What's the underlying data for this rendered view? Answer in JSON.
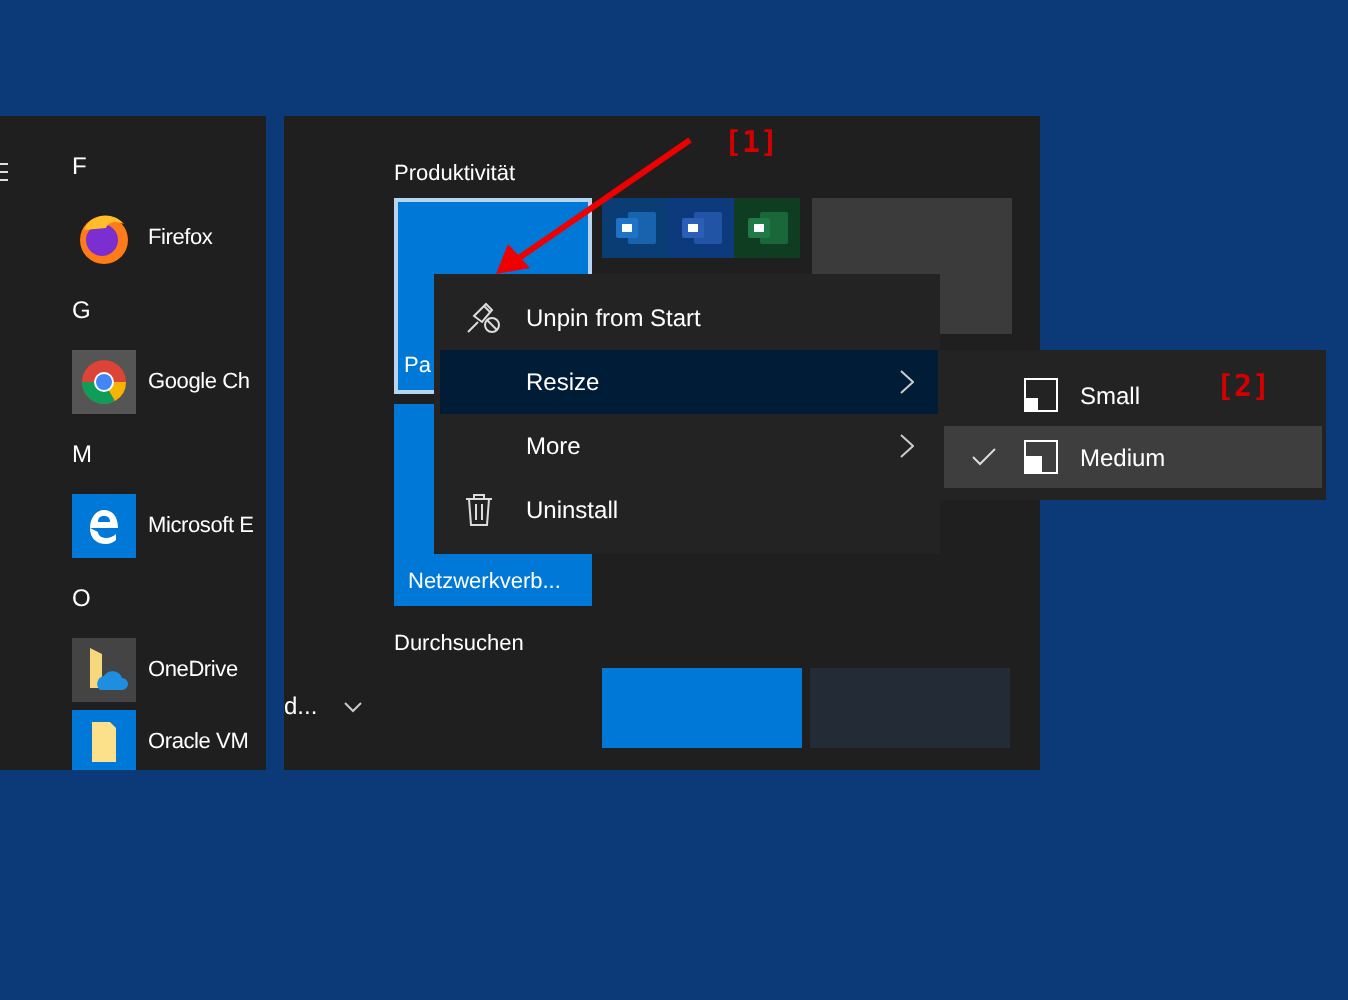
{
  "app_list": {
    "groups": [
      {
        "letter": "F",
        "apps": [
          {
            "name": "Firefox",
            "kind": "firefox"
          }
        ]
      },
      {
        "letter": "G",
        "apps": [
          {
            "name": "Google Ch",
            "kind": "chrome"
          }
        ]
      },
      {
        "letter": "M",
        "apps": [
          {
            "name": "Microsoft E",
            "kind": "edge"
          }
        ]
      },
      {
        "letter": "O",
        "apps": [
          {
            "name": "OneDrive",
            "kind": "onedrive"
          },
          {
            "name": "Oracle VM",
            "kind": "folder"
          }
        ]
      }
    ]
  },
  "tiles": {
    "groups": [
      {
        "title": "Produktivität"
      },
      {
        "title": "Durchsuchen"
      }
    ],
    "selected_tile": {
      "label": "Pa",
      "selected": true
    },
    "second_tile": {
      "label": "Netzwerkverb..."
    },
    "office_tiles": [
      {
        "kind": "outlook"
      },
      {
        "kind": "word"
      },
      {
        "kind": "excel"
      }
    ],
    "overflow_label": "d..."
  },
  "context_menu": {
    "items": [
      {
        "label": "Unpin from Start",
        "kind": "unpin",
        "submenu": false,
        "selected": false
      },
      {
        "label": "Resize",
        "kind": "none",
        "submenu": true,
        "selected": true
      },
      {
        "label": "More",
        "kind": "none",
        "submenu": true,
        "selected": false
      },
      {
        "label": "Uninstall",
        "kind": "trash",
        "submenu": false,
        "selected": false
      }
    ]
  },
  "resize_menu": {
    "items": [
      {
        "label": "Small",
        "kind": "small",
        "checked": false,
        "selected": false
      },
      {
        "label": "Medium",
        "kind": "medium",
        "checked": true,
        "selected": true
      }
    ]
  },
  "annotations": [
    "[1]",
    "[2]"
  ]
}
